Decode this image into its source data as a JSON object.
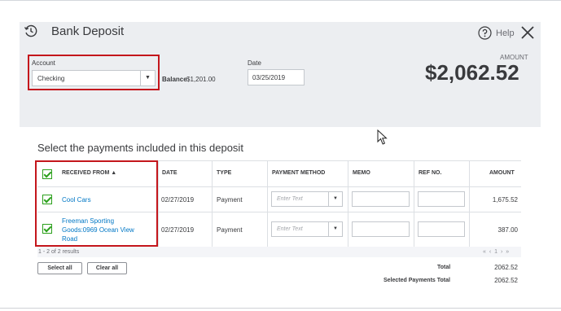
{
  "dialog": {
    "title": "Bank Deposit",
    "help_label": "Help"
  },
  "account": {
    "label": "Account",
    "value": "Checking",
    "balance_label": "Balance",
    "balance_value": "$1,201.00"
  },
  "date": {
    "label": "Date",
    "value": "03/25/2019"
  },
  "amount": {
    "label": "AMOUNT",
    "value": "$2,062.52"
  },
  "section_title": "Select the payments included in this deposit",
  "table": {
    "columns": [
      "RECEIVED FROM ▲",
      "DATE",
      "TYPE",
      "PAYMENT METHOD",
      "MEMO",
      "REF NO.",
      "AMOUNT"
    ],
    "payment_placeholder": "Enter Text",
    "rows": [
      {
        "checked": true,
        "received_from": "Cool Cars",
        "date": "02/27/2019",
        "type": "Payment",
        "payment_method": "",
        "memo": "",
        "ref_no": "",
        "amount": "1,675.52"
      },
      {
        "checked": true,
        "received_from_lines": [
          "Freeman Sporting",
          "Goods:0969 Ocean View",
          "Road"
        ],
        "date": "02/27/2019",
        "type": "Payment",
        "payment_method": "",
        "memo": "",
        "ref_no": "",
        "amount": "387.00"
      }
    ],
    "results_text": "1 - 2 of 2 results",
    "pager": "« ‹ 1 › »"
  },
  "buttons": {
    "select_all": "Select all",
    "clear_all": "Clear all"
  },
  "totals": {
    "total_label": "Total",
    "total_value": "2062.52",
    "selected_label": "Selected Payments Total",
    "selected_value": "2062.52"
  },
  "colors": {
    "header_bg": "#eceef1",
    "link": "#0077c5",
    "check": "#2ca01c",
    "highlight_box": "#c4161c"
  }
}
